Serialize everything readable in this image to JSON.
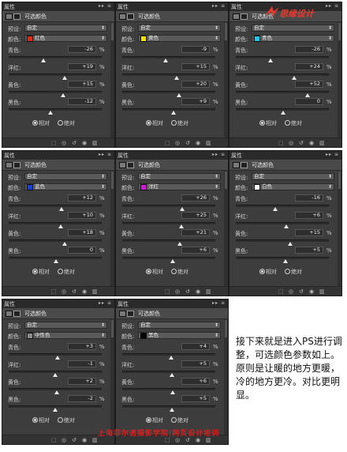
{
  "caption": "接下来就是进入PS进行调整，可选颜色参数如上。原则是让暖的地方更暖，冷的地方更冷。对比更明显。",
  "logo_text": "思缘设计",
  "watermark": "上海菲尔透摄影学院|网页设计培训",
  "colors": {
    "accent": "#e23a2e"
  },
  "ui_labels": {
    "tab": "属性",
    "title": "可选颜色",
    "preset_label": "预设:",
    "preset_value": "自定",
    "colors_label": "颜色:",
    "cyan_label": "青色:",
    "magenta_label": "洋红:",
    "yellow_label": "黄色:",
    "black_label": "黑色:",
    "relative_label": "相对",
    "absolute_label": "绝对",
    "tab_controls": "▸▸ ≡",
    "percent": "%"
  },
  "panels": [
    {
      "color_name": "红色",
      "swatch": "#e22a1a",
      "cyan": "-26",
      "magenta": "+19",
      "yellow": "+15",
      "black": "-12"
    },
    {
      "color_name": "黄色",
      "swatch": "#f2e600",
      "cyan": "-9",
      "magenta": "+15",
      "yellow": "+20",
      "black": "+9"
    },
    {
      "color_name": "青色",
      "swatch": "#1ec8e8",
      "cyan": "-26",
      "magenta": "+24",
      "yellow": "+52",
      "black": "0"
    },
    {
      "color_name": "蓝色",
      "swatch": "#1a3fd8",
      "cyan": "+12",
      "magenta": "+10",
      "yellow": "+18",
      "black": "0"
    },
    {
      "color_name": "洋红",
      "swatch": "#d21ad6",
      "cyan": "+26",
      "magenta": "+25",
      "yellow": "+21",
      "black": "+6"
    },
    {
      "color_name": "白色",
      "swatch": "#ffffff",
      "cyan": "-16",
      "magenta": "+6",
      "yellow": "+15",
      "black": "+5"
    },
    {
      "color_name": "中性色",
      "swatch": "#8a8a8a",
      "cyan": "+3",
      "magenta": "-1",
      "yellow": "+2",
      "black": "-2"
    },
    {
      "color_name": "黑色",
      "swatch": "#050505",
      "cyan": "+4",
      "magenta": "+5",
      "yellow": "+6",
      "black": "+5"
    }
  ]
}
